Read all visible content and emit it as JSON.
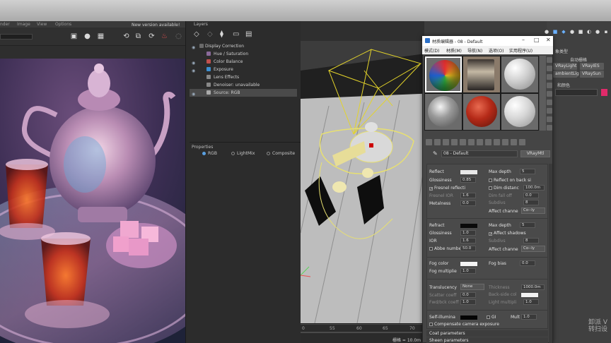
{
  "vfb": {
    "menu": [
      "nder",
      "Image",
      "View",
      "Options"
    ],
    "update_notice": "New version available!"
  },
  "layers": {
    "title": "Layers",
    "items": [
      {
        "label": "Display Correction",
        "icon_color": "#6a6a6a"
      },
      {
        "label": "Hue / Saturation",
        "icon_color": "#8a6a9a"
      },
      {
        "label": "Color Balance",
        "icon_color": "#c0504d"
      },
      {
        "label": "Exposure",
        "icon_color": "#3c8fd0"
      },
      {
        "label": "Lens Effects",
        "icon_color": "#888888"
      },
      {
        "label": "Denoiser: unavailable",
        "icon_color": "#888888"
      },
      {
        "label": "Source: RGB",
        "icon_color": "#aaaaaa"
      }
    ]
  },
  "properties": {
    "title": "Properties",
    "options": [
      "RGB",
      "LightMix",
      "Composite"
    ]
  },
  "timeline": {
    "ticks": [
      "0",
      "55",
      "60",
      "65",
      "70",
      "75",
      "80",
      "85",
      "90",
      "95"
    ],
    "status": "栅格 = 10.0m"
  },
  "command_panel": {
    "object_type_label": "象类型",
    "auto_grid": "自动栅格",
    "buttons": [
      "VRayLight",
      "VRayIES",
      "ambientLig",
      "VRaySun"
    ],
    "name_color_label": "和颜色"
  },
  "material_editor": {
    "title": "材质编辑器 - 08 - Default",
    "menu": [
      "模式(D)",
      "材质(M)",
      "导航(N)",
      "选项(O)",
      "实用程序(U)"
    ],
    "material_name": "08 - Default",
    "material_type": "VRayMtl",
    "params": {
      "reflect": "Reflect",
      "glossiness": "Glossiness",
      "glossiness_value": "0.85",
      "fresnel": "Fresnel reflecti",
      "fresnel_ior": "Fresnel IOR",
      "fresnel_ior_value": "1.6",
      "metalness": "Metalness",
      "metalness_value": "0.0",
      "max_depth": "Max depth",
      "max_depth_value": "5",
      "reflect_backside": "Reflect on back si",
      "dim_distance": "Dim distanc",
      "dim_distance_value": "100.0m",
      "dim_falloff": "Dim fall off",
      "dim_falloff_value": "0.0",
      "affect_channels": "Affect channe",
      "affect_channels_value": "Co--ly",
      "subdivs": "Subdivs",
      "subdivs_value": "8",
      "refract": "Refract",
      "glossiness2": "Glossiness",
      "glossiness2_value": "1.0",
      "ior": "IOR",
      "ior_value": "1.6",
      "abbe": "Abbe number",
      "abbe_value": "50.0",
      "max_depth2": "Max depth",
      "max_depth2_value": "5",
      "affect_shadows": "Affect shadows",
      "subdivs2": "Subdivs",
      "subdivs2_value": "8",
      "affect_channels2": "Affect channe",
      "affect_channels2_value": "Co--ly",
      "fog_color": "Fog color",
      "fog_bias": "Fog bias",
      "fog_bias_value": "0.0",
      "fog_multiplier": "Fog multiplie",
      "fog_multiplier_value": "1.0",
      "translucency": "Translucency",
      "translucency_value": "None",
      "thickness": "Thickness",
      "thickness_value": "1000.0m",
      "scatter_coeff": "Scatter coeff",
      "scatter_coeff_value": "0.0",
      "fwd_bck": "Fwd/bck coeff",
      "fwd_bck_value": "1.0",
      "back_side_color": "Back-side col",
      "light_multiplier": "Light multipli",
      "light_multiplier_value": "1.0",
      "self_illum": "Self-illumina",
      "gi": "GI",
      "mult": "Mult",
      "mult_value": "1.0",
      "compensate": "Compensate camera exposure"
    },
    "rollouts": [
      "Coat parameters",
      "Sheen parameters"
    ]
  },
  "watermark": "卸派 V\n转扫设"
}
